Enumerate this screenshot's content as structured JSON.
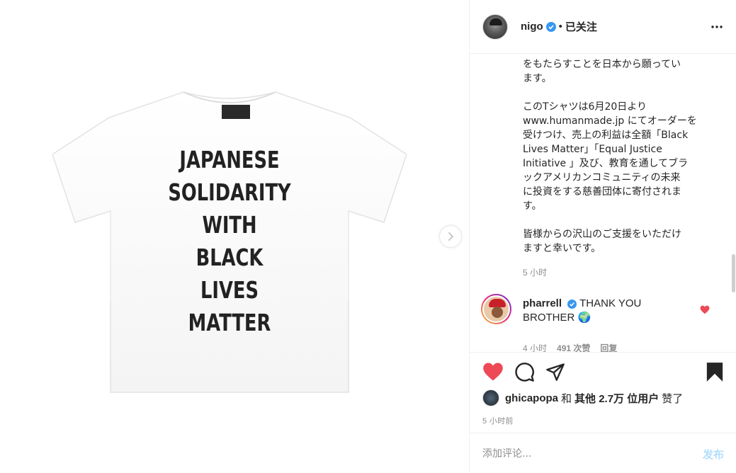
{
  "post": {
    "shirt_print": [
      "JAPANESE",
      "SOLIDARITY",
      "WITH",
      "BLACK",
      "LIVES",
      "MATTER"
    ]
  },
  "header": {
    "username": "nigo",
    "separator": "•",
    "follow_status": "已关注"
  },
  "caption": {
    "text": "をもたらすことを日本から願ってい\nます。\n\nこのTシャツは6月20日より\nwww.humanmade.jp にてオーダーを\n受けつけ、売上の利益は全額「Black\nLives Matter」「Equal Justice\nInitiative 」及び、教育を通してブラ\nックアメリカンコミュニティの未来\nに投資をする慈善団体に寄付されま\nす。\n\n皆様からの沢山のご支援をいただけ\nますと幸いです。",
    "time": "5 小时"
  },
  "comment": {
    "username": "pharrell",
    "text": "THANK YOU BROTHER",
    "emoji": "🌍",
    "time": "4 小时",
    "likes": "491 次赞",
    "reply": "回复"
  },
  "likes_line": {
    "user": "ghicapopa",
    "and": "和",
    "others": "其他 2.7万 位用户",
    "liked": "赞了"
  },
  "post_time": "5 小时前",
  "comment_box": {
    "placeholder": "添加评论...",
    "post_label": "发布"
  },
  "colors": {
    "like_red": "#ed4956",
    "verified_blue": "#3897f0",
    "post_disabled": "#b2dffc",
    "muted_text": "#8e8e8e"
  },
  "icons": {
    "next": "chevron-right-icon",
    "more": "more-options-icon",
    "like": "heart-filled-icon",
    "comment": "comment-bubble-icon",
    "share": "paper-plane-icon",
    "save": "bookmark-filled-icon",
    "verified": "verified-badge-icon"
  }
}
